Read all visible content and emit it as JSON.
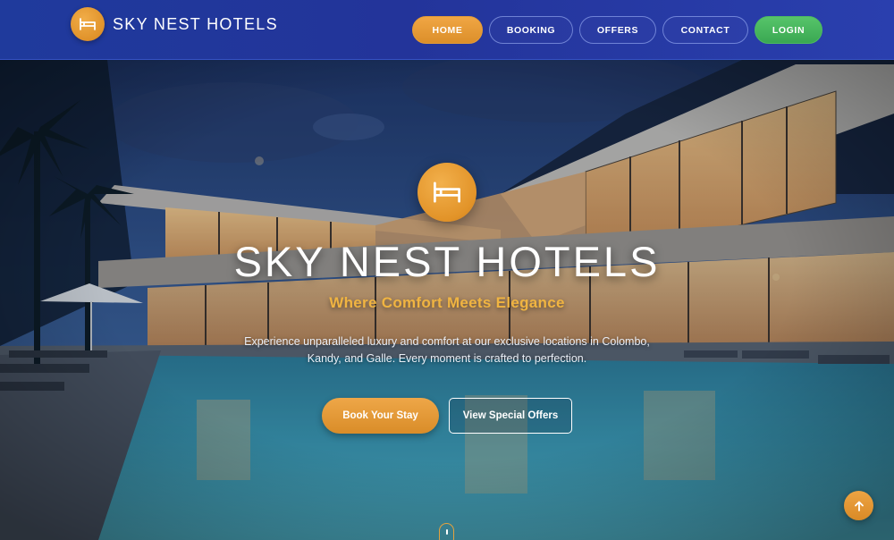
{
  "brand": {
    "name": "SKY NEST HOTELS",
    "icon": "bed-icon"
  },
  "nav": {
    "items": [
      {
        "label": "HOME",
        "active": true
      },
      {
        "label": "BOOKING",
        "active": false
      },
      {
        "label": "OFFERS",
        "active": false
      },
      {
        "label": "CONTACT",
        "active": false
      }
    ],
    "login_label": "LOGIN"
  },
  "hero": {
    "icon": "bed-icon",
    "title": "SKY NEST HOTELS",
    "tagline": "Where Comfort Meets Elegance",
    "description": "Experience unparalleled luxury and comfort at our exclusive locations in Colombo, Kandy, and Galle. Every moment is crafted to perfection.",
    "primary_cta": "Book Your Stay",
    "secondary_cta": "View Special Offers"
  },
  "controls": {
    "scroll_indicator_icon": "mouse-scroll-icon",
    "back_to_top_icon": "arrow-up-icon"
  },
  "colors": {
    "nav_bg": "#23349a",
    "accent_orange": "#e2962e",
    "login_green": "#45b45a",
    "tagline_gold": "#f0b441"
  }
}
